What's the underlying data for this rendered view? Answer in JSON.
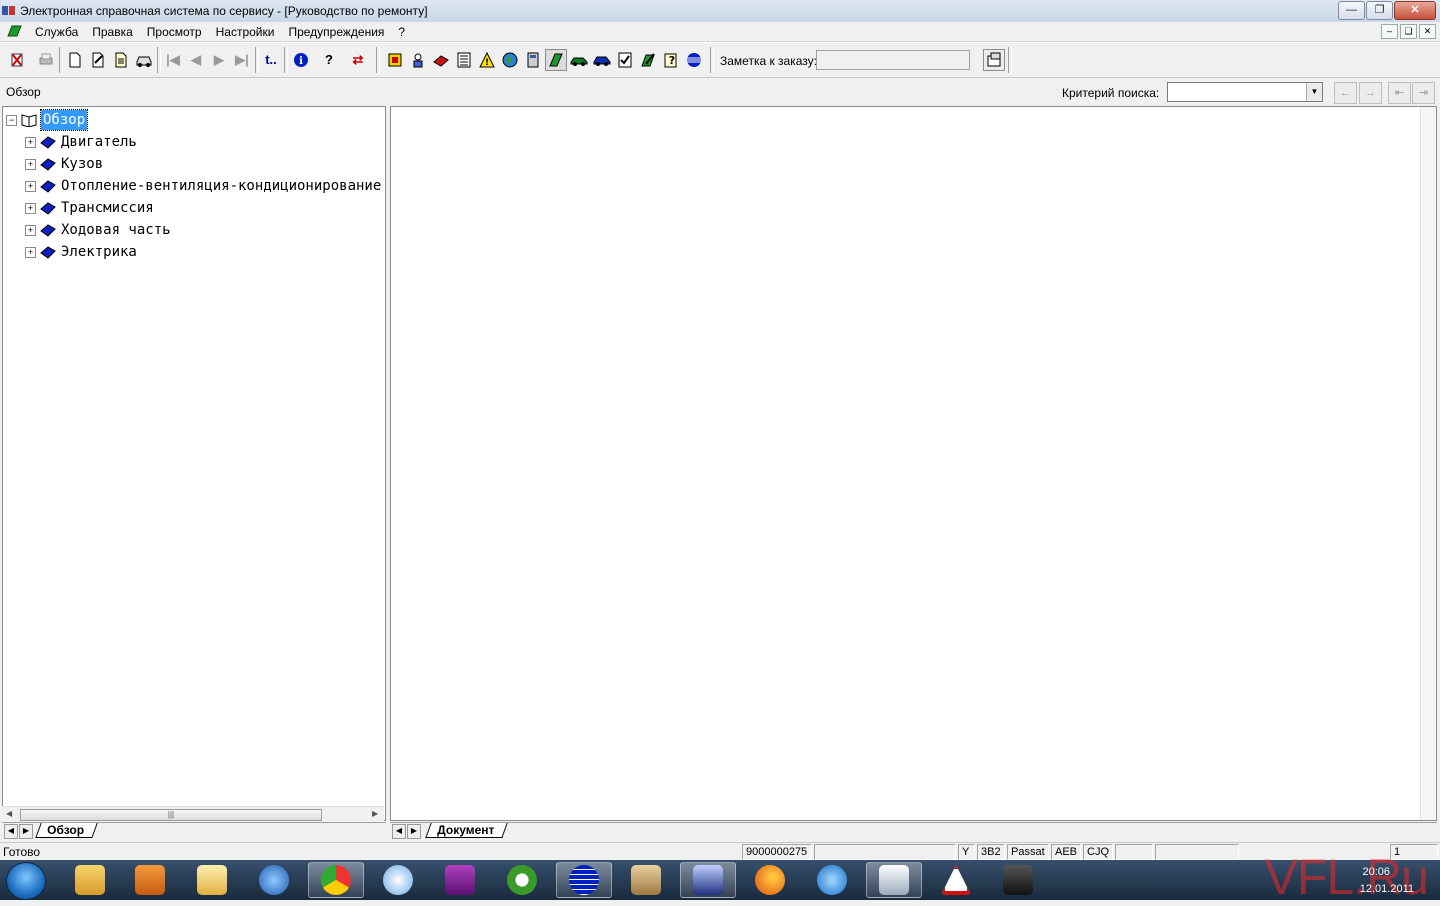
{
  "window": {
    "title": "Электронная справочная система по сервису - [Руководство по ремонту]",
    "controls": [
      "minimize",
      "maximize",
      "close"
    ]
  },
  "menu": {
    "items": [
      "Служба",
      "Правка",
      "Просмотр",
      "Настройки",
      "Предупреждения",
      "?"
    ],
    "app_icon": "green-book-icon"
  },
  "toolbar": {
    "groups": [
      [
        "exit-icon",
        "print-icon"
      ],
      [
        "new-doc-icon",
        "edit-doc-icon",
        "page-icon",
        "car-icon"
      ],
      [
        "first-icon",
        "prev-icon",
        "next-icon",
        "last-icon"
      ],
      [
        "up-level-icon"
      ],
      [
        "info-icon",
        "help-icon",
        "swap-icon"
      ],
      [
        "module-icon",
        "person-icon",
        "red-book-icon",
        "list-icon",
        "warning-icon",
        "globe-icon",
        "calculator-icon",
        "green-book-icon",
        "car-green-icon",
        "car-blue-icon",
        "checklist-icon",
        "edit-green-icon",
        "question-doc-icon",
        "blue-sphere-icon"
      ]
    ],
    "note_label": "Заметка к заказу:",
    "note_value": "",
    "note_button_icon": "note-icon"
  },
  "subbar": {
    "overview_label": "Обзор",
    "search_label": "Критерий поиска:",
    "search_value": "",
    "search_buttons": [
      "search-prev-icon",
      "search-next-icon",
      "nav-back-icon",
      "nav-forward-icon"
    ]
  },
  "tree": {
    "root": "Обзор",
    "items": [
      "Двигатель",
      "Кузов",
      "Отопление-вентиляция-кондиционирование",
      "Трансмиссия",
      "Ходовая часть",
      "Электрика"
    ]
  },
  "tabs": {
    "left": "Обзор",
    "right": "Документ"
  },
  "status": {
    "text": "Готово",
    "order_number": "9000000275",
    "cells": [
      "Y",
      "3B2",
      "Passat",
      "AEB",
      "CJQ"
    ],
    "page": "1"
  },
  "taskbar": {
    "apps": [
      "explorer-icon",
      "media-player-icon",
      "mail-icon",
      "arrow-app-icon",
      "chrome-icon",
      "disc-app-icon",
      "luxor-game-icon",
      "utorrent-icon",
      "blue-sphere-app-icon",
      "download-icon",
      "car-service-icon",
      "firefox-icon",
      "ie-icon",
      "presentation-icon",
      "road-sign-icon",
      "camera-icon"
    ],
    "clock_time": "20:06",
    "clock_date": "12.01.2011",
    "watermark": "VFL.Ru"
  },
  "colors": {
    "selection": "#3399ff",
    "book_blue": "#1020c0",
    "taskbar": "#27405c"
  }
}
